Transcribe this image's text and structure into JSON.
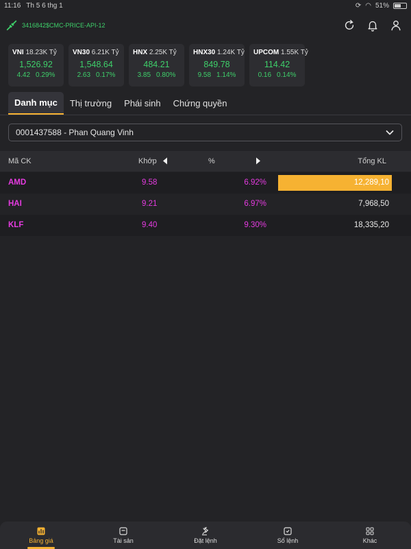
{
  "status_bar": {
    "time": "11:16",
    "date": "Th 5 6 thg 1",
    "battery": "51%"
  },
  "header": {
    "connection_label": "3416842$CMC-PRICE-API-12"
  },
  "indices": [
    {
      "name": "VNI",
      "value_volume": "18.23K Tỷ",
      "price": "1,526.92",
      "change": "4.42",
      "percent": "0.29%"
    },
    {
      "name": "VN30",
      "value_volume": "6.21K Tỷ",
      "price": "1,548.64",
      "change": "2.63",
      "percent": "0.17%"
    },
    {
      "name": "HNX",
      "value_volume": "2.25K Tỷ",
      "price": "484.21",
      "change": "3.85",
      "percent": "0.80%"
    },
    {
      "name": "HNX30",
      "value_volume": "1.24K Tỷ",
      "price": "849.78",
      "change": "9.58",
      "percent": "1.14%"
    },
    {
      "name": "UPCOM",
      "value_volume": "1.55K Tỷ",
      "price": "114.42",
      "change": "0.16",
      "percent": "0.14%"
    }
  ],
  "tabs": [
    {
      "label": "Danh mục",
      "active": true
    },
    {
      "label": "Thị trường",
      "active": false
    },
    {
      "label": "Phái sinh",
      "active": false
    },
    {
      "label": "Chứng quyền",
      "active": false
    }
  ],
  "account_select": {
    "value": "0001437588 - Phan Quang Vinh"
  },
  "table": {
    "headers": {
      "code": "Mã CK",
      "match": "Khớp",
      "percent": "%",
      "volume": "Tổng KL"
    },
    "rows": [
      {
        "code": "AMD",
        "price": "9.58",
        "percent": "6.92%",
        "volume": "12,289,10"
      },
      {
        "code": "HAI",
        "price": "9.21",
        "percent": "6.97%",
        "volume": "7,968,50"
      },
      {
        "code": "KLF",
        "price": "9.40",
        "percent": "9.30%",
        "volume": "18,335,20"
      }
    ]
  },
  "bottom_nav": [
    {
      "label": "Bảng giá",
      "icon": "chart-icon",
      "active": true
    },
    {
      "label": "Tài sản",
      "icon": "wallet-icon",
      "active": false
    },
    {
      "label": "Đặt lệnh",
      "icon": "gavel-icon",
      "active": false
    },
    {
      "label": "Sổ lệnh",
      "icon": "order-book-icon",
      "active": false
    },
    {
      "label": "Khác",
      "icon": "grid-icon",
      "active": false
    }
  ],
  "colors": {
    "background": "#232326",
    "up_green": "#3ecf6a",
    "ceiling_magenta": "#e53be0",
    "accent_amber": "#f6b232"
  }
}
